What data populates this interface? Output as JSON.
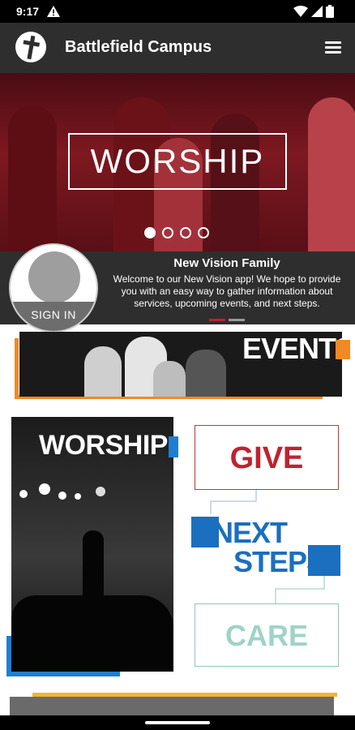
{
  "status_bar": {
    "time": "9:17",
    "icons": [
      "alert-icon",
      "wifi-icon",
      "signal-icon",
      "battery-icon"
    ]
  },
  "app_bar": {
    "title": "Battlefield Campus",
    "logo_icon": "cross-logo-icon",
    "menu_icon": "hamburger-menu-icon"
  },
  "hero": {
    "slide_title": "WORSHIP",
    "slide_count": 4,
    "active_slide": 1
  },
  "welcome": {
    "title": "New Vision Family",
    "message": "Welcome to our New Vision app! We hope to provide you with an easy way to gather information about services, upcoming events, and next steps.",
    "sign_in_label": "SIGN IN"
  },
  "tiles": {
    "events": "EVENTS",
    "worship": "WORSHIP",
    "give": "GIVE",
    "next_steps_line1": "NEXT",
    "next_steps_line2": "STEPS",
    "care": "CARE"
  },
  "colors": {
    "app_bar": "#2e2e2e",
    "hero_tint": "#7d1820",
    "events_accent": "#f08a24",
    "worship_accent": "#1e7fd1",
    "give": "#c0222f",
    "next_steps": "#1b6fbf",
    "care": "#9fd3c7",
    "bottom_accent": "#f2b632"
  }
}
